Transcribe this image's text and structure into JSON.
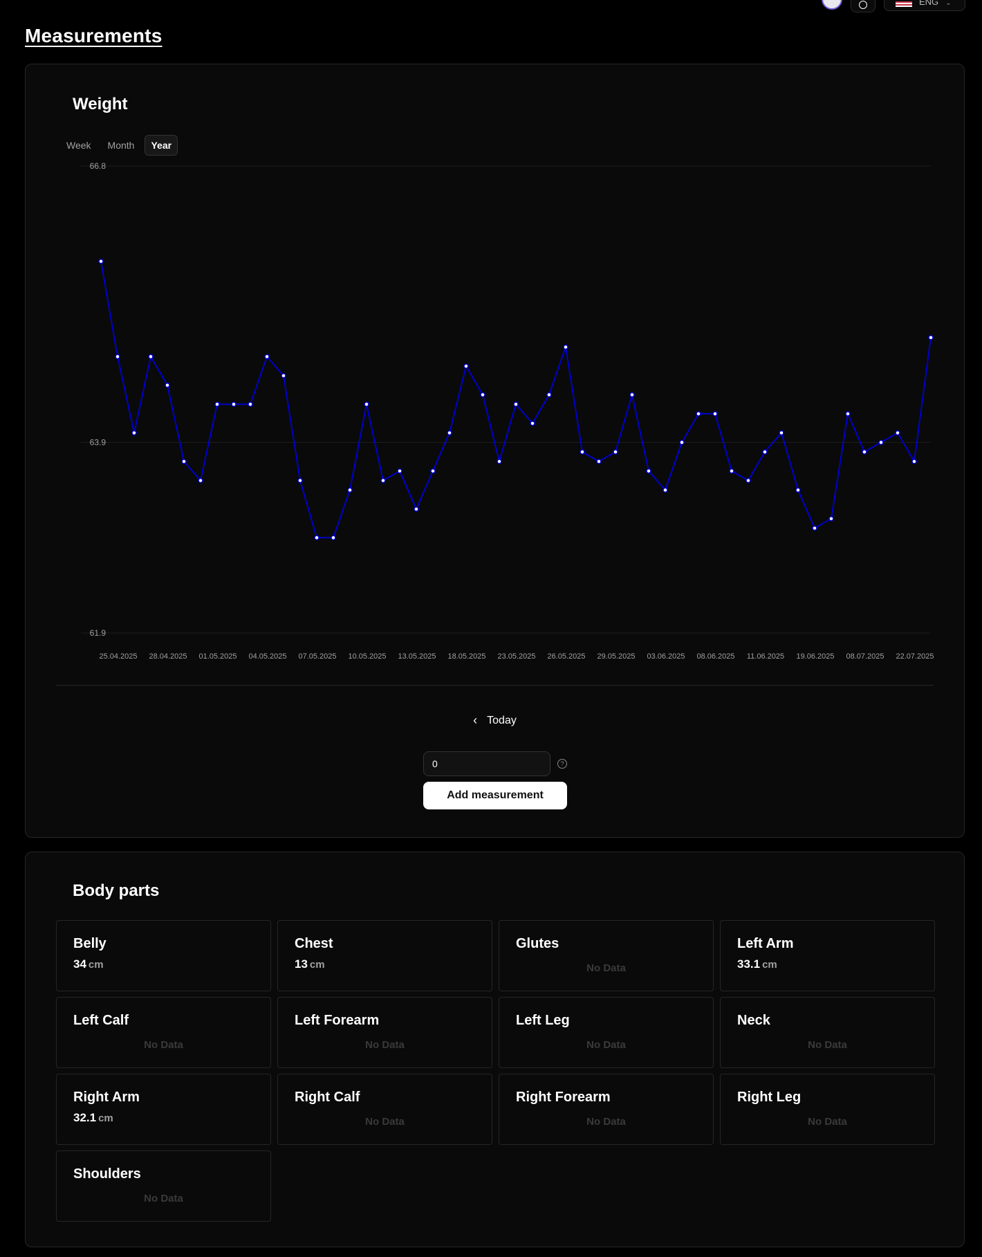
{
  "header": {
    "language": "ENG"
  },
  "page": {
    "title": "Measurements"
  },
  "weight": {
    "title": "Weight",
    "tabs": [
      {
        "label": "Week",
        "active": false
      },
      {
        "label": "Month",
        "active": false
      },
      {
        "label": "Year",
        "active": true
      }
    ],
    "nav_label": "Today",
    "input_value": "0",
    "add_button": "Add measurement"
  },
  "chart_data": {
    "type": "line",
    "line_color": "#0000cc",
    "y_ticks": [
      "66.8",
      "63.9",
      "61.9"
    ],
    "ylim": [
      61.9,
      66.8
    ],
    "x_tick_labels": [
      "25.04.2025",
      "28.04.2025",
      "01.05.2025",
      "04.05.2025",
      "07.05.2025",
      "10.05.2025",
      "13.05.2025",
      "18.05.2025",
      "23.05.2025",
      "26.05.2025",
      "29.05.2025",
      "03.06.2025",
      "08.06.2025",
      "11.06.2025",
      "19.06.2025",
      "08.07.2025",
      "22.07.2025"
    ],
    "values": [
      65.8,
      64.8,
      64.0,
      64.8,
      64.5,
      63.7,
      63.5,
      64.3,
      64.3,
      64.3,
      64.8,
      64.6,
      63.5,
      62.9,
      62.9,
      63.4,
      64.3,
      63.5,
      63.6,
      63.2,
      63.6,
      64.0,
      64.7,
      64.4,
      63.7,
      64.3,
      64.1,
      64.4,
      64.9,
      63.8,
      63.7,
      63.8,
      64.4,
      63.6,
      63.4,
      63.9,
      64.2,
      64.2,
      63.6,
      63.5,
      63.8,
      64.0,
      63.4,
      63.0,
      63.1,
      64.2,
      63.8,
      63.9,
      64.0,
      63.7,
      65.0
    ],
    "grid": true
  },
  "body_parts": {
    "title": "Body parts",
    "no_data": "No Data",
    "items": [
      {
        "name": "Belly",
        "value": "34",
        "unit": "cm"
      },
      {
        "name": "Chest",
        "value": "13",
        "unit": "cm"
      },
      {
        "name": "Glutes",
        "value": null,
        "unit": null
      },
      {
        "name": "Left Arm",
        "value": "33.1",
        "unit": "cm"
      },
      {
        "name": "Left Calf",
        "value": null,
        "unit": null
      },
      {
        "name": "Left Forearm",
        "value": null,
        "unit": null
      },
      {
        "name": "Left Leg",
        "value": null,
        "unit": null
      },
      {
        "name": "Neck",
        "value": null,
        "unit": null
      },
      {
        "name": "Right Arm",
        "value": "32.1",
        "unit": "cm"
      },
      {
        "name": "Right Calf",
        "value": null,
        "unit": null
      },
      {
        "name": "Right Forearm",
        "value": null,
        "unit": null
      },
      {
        "name": "Right Leg",
        "value": null,
        "unit": null
      },
      {
        "name": "Shoulders",
        "value": null,
        "unit": null
      }
    ]
  }
}
